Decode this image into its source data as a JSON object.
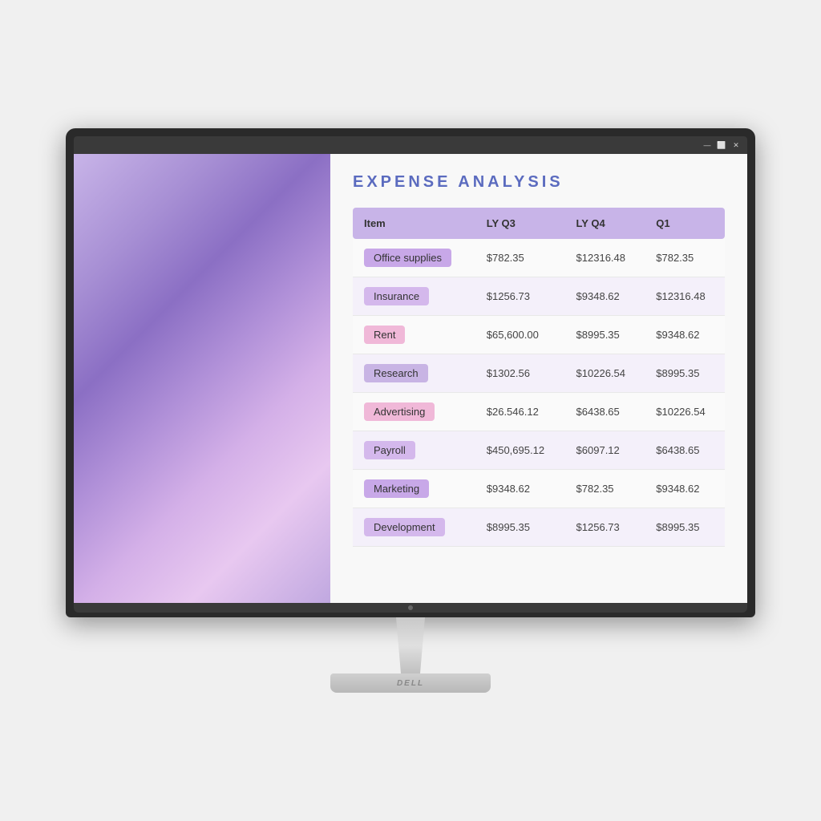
{
  "window": {
    "title_buttons": {
      "minimize": "—",
      "maximize": "⬜",
      "close": "✕"
    }
  },
  "page": {
    "title": "EXPENSE ANALYSIS"
  },
  "table": {
    "headers": [
      "Item",
      "LY Q3",
      "LY Q4",
      "Q1"
    ],
    "rows": [
      {
        "item": "Office supplies",
        "lyq3": "$782.35",
        "lyq4": "$12316.48",
        "q1": "$782.35"
      },
      {
        "item": "Insurance",
        "lyq3": "$1256.73",
        "lyq4": "$9348.62",
        "q1": "$12316.48"
      },
      {
        "item": "Rent",
        "lyq3": "$65,600.00",
        "lyq4": "$8995.35",
        "q1": "$9348.62"
      },
      {
        "item": "Research",
        "lyq3": "$1302.56",
        "lyq4": "$10226.54",
        "q1": "$8995.35"
      },
      {
        "item": "Advertising",
        "lyq3": "$26.546.12",
        "lyq4": "$6438.65",
        "q1": "$10226.54"
      },
      {
        "item": "Payroll",
        "lyq3": "$450,695.12",
        "lyq4": "$6097.12",
        "q1": "$6438.65"
      },
      {
        "item": "Marketing",
        "lyq3": "$9348.62",
        "lyq4": "$782.35",
        "q1": "$9348.62"
      },
      {
        "item": "Development",
        "lyq3": "$8995.35",
        "lyq4": "$1256.73",
        "q1": "$8995.35"
      }
    ]
  },
  "monitor": {
    "brand": "DELL"
  }
}
